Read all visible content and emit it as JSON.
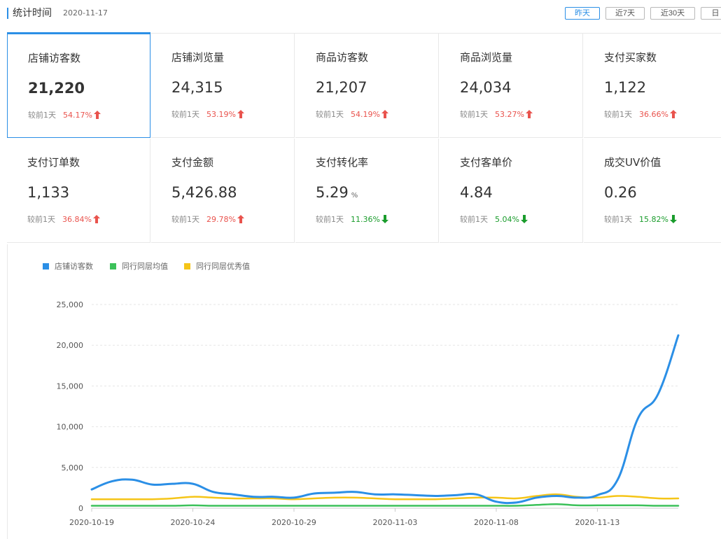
{
  "header": {
    "title": "统计时间",
    "date": "2020-11-17",
    "ranges": [
      {
        "label": "昨天",
        "active": true
      },
      {
        "label": "近7天",
        "active": false
      },
      {
        "label": "近30天",
        "active": false
      },
      {
        "label": "日",
        "active": false
      }
    ]
  },
  "metrics": [
    {
      "label": "店铺访客数",
      "value": "21,220",
      "unit": "",
      "compare_label": "较前1天",
      "pct": "54.17%",
      "trend": "up",
      "selected": true
    },
    {
      "label": "店铺浏览量",
      "value": "24,315",
      "unit": "",
      "compare_label": "较前1天",
      "pct": "53.19%",
      "trend": "up",
      "selected": false
    },
    {
      "label": "商品访客数",
      "value": "21,207",
      "unit": "",
      "compare_label": "较前1天",
      "pct": "54.19%",
      "trend": "up",
      "selected": false
    },
    {
      "label": "商品浏览量",
      "value": "24,034",
      "unit": "",
      "compare_label": "较前1天",
      "pct": "53.27%",
      "trend": "up",
      "selected": false
    },
    {
      "label": "支付买家数",
      "value": "1,122",
      "unit": "",
      "compare_label": "较前1天",
      "pct": "36.66%",
      "trend": "up",
      "selected": false
    },
    {
      "label": "支付订单数",
      "value": "1,133",
      "unit": "",
      "compare_label": "较前1天",
      "pct": "36.84%",
      "trend": "up",
      "selected": false
    },
    {
      "label": "支付金额",
      "value": "5,426.88",
      "unit": "",
      "compare_label": "较前1天",
      "pct": "29.78%",
      "trend": "up",
      "selected": false
    },
    {
      "label": "支付转化率",
      "value": "5.29",
      "unit": "%",
      "compare_label": "较前1天",
      "pct": "11.36%",
      "trend": "down",
      "selected": false
    },
    {
      "label": "支付客单价",
      "value": "4.84",
      "unit": "",
      "compare_label": "较前1天",
      "pct": "5.04%",
      "trend": "down",
      "selected": false
    },
    {
      "label": "成交UV价值",
      "value": "0.26",
      "unit": "",
      "compare_label": "较前1天",
      "pct": "15.82%",
      "trend": "down",
      "selected": false
    }
  ],
  "colors": {
    "accent": "#2b8fe6",
    "up": "#e9534d",
    "down": "#1a9c2c",
    "series_store": "#2b8fe6",
    "series_avg": "#3cc15a",
    "series_excellent": "#f5c518",
    "grid": "#e6e6e6"
  },
  "chart_data": {
    "type": "line",
    "x": [
      "2020-10-19",
      "2020-10-20",
      "2020-10-21",
      "2020-10-22",
      "2020-10-23",
      "2020-10-24",
      "2020-10-25",
      "2020-10-26",
      "2020-10-27",
      "2020-10-28",
      "2020-10-29",
      "2020-10-30",
      "2020-10-31",
      "2020-11-01",
      "2020-11-02",
      "2020-11-03",
      "2020-11-04",
      "2020-11-05",
      "2020-11-06",
      "2020-11-07",
      "2020-11-08",
      "2020-11-09",
      "2020-11-10",
      "2020-11-11",
      "2020-11-12",
      "2020-11-13",
      "2020-11-14",
      "2020-11-15",
      "2020-11-16",
      "2020-11-17"
    ],
    "x_ticks": [
      "2020-10-19",
      "2020-10-24",
      "2020-10-29",
      "2020-11-03",
      "2020-11-08",
      "2020-11-13"
    ],
    "y_ticks": [
      0,
      5000,
      10000,
      15000,
      20000,
      25000
    ],
    "y_tick_labels": [
      "0",
      "5,000",
      "10,000",
      "15,000",
      "20,000",
      "25,000"
    ],
    "ylim": [
      0,
      25000
    ],
    "grid": "horizontal-dashed",
    "legend_position": "top-left",
    "series": [
      {
        "name": "店铺访客数",
        "color": "#2b8fe6",
        "values": [
          2300,
          3300,
          3500,
          2900,
          3000,
          3000,
          2000,
          1700,
          1400,
          1400,
          1300,
          1800,
          1900,
          2000,
          1700,
          1700,
          1600,
          1500,
          1600,
          1700,
          800,
          700,
          1300,
          1500,
          1300,
          1600,
          3500,
          11000,
          14000,
          21220
        ]
      },
      {
        "name": "同行同层均值",
        "color": "#3cc15a",
        "values": [
          300,
          300,
          300,
          300,
          300,
          350,
          300,
          300,
          300,
          300,
          300,
          300,
          300,
          300,
          300,
          300,
          300,
          300,
          300,
          300,
          300,
          300,
          400,
          500,
          350,
          350,
          350,
          350,
          300,
          300
        ]
      },
      {
        "name": "同行同层优秀值",
        "color": "#f5c518",
        "values": [
          1100,
          1100,
          1100,
          1100,
          1200,
          1400,
          1300,
          1200,
          1200,
          1200,
          1100,
          1200,
          1300,
          1300,
          1200,
          1100,
          1100,
          1100,
          1200,
          1300,
          1300,
          1200,
          1500,
          1700,
          1400,
          1300,
          1500,
          1400,
          1200,
          1200
        ]
      }
    ]
  }
}
